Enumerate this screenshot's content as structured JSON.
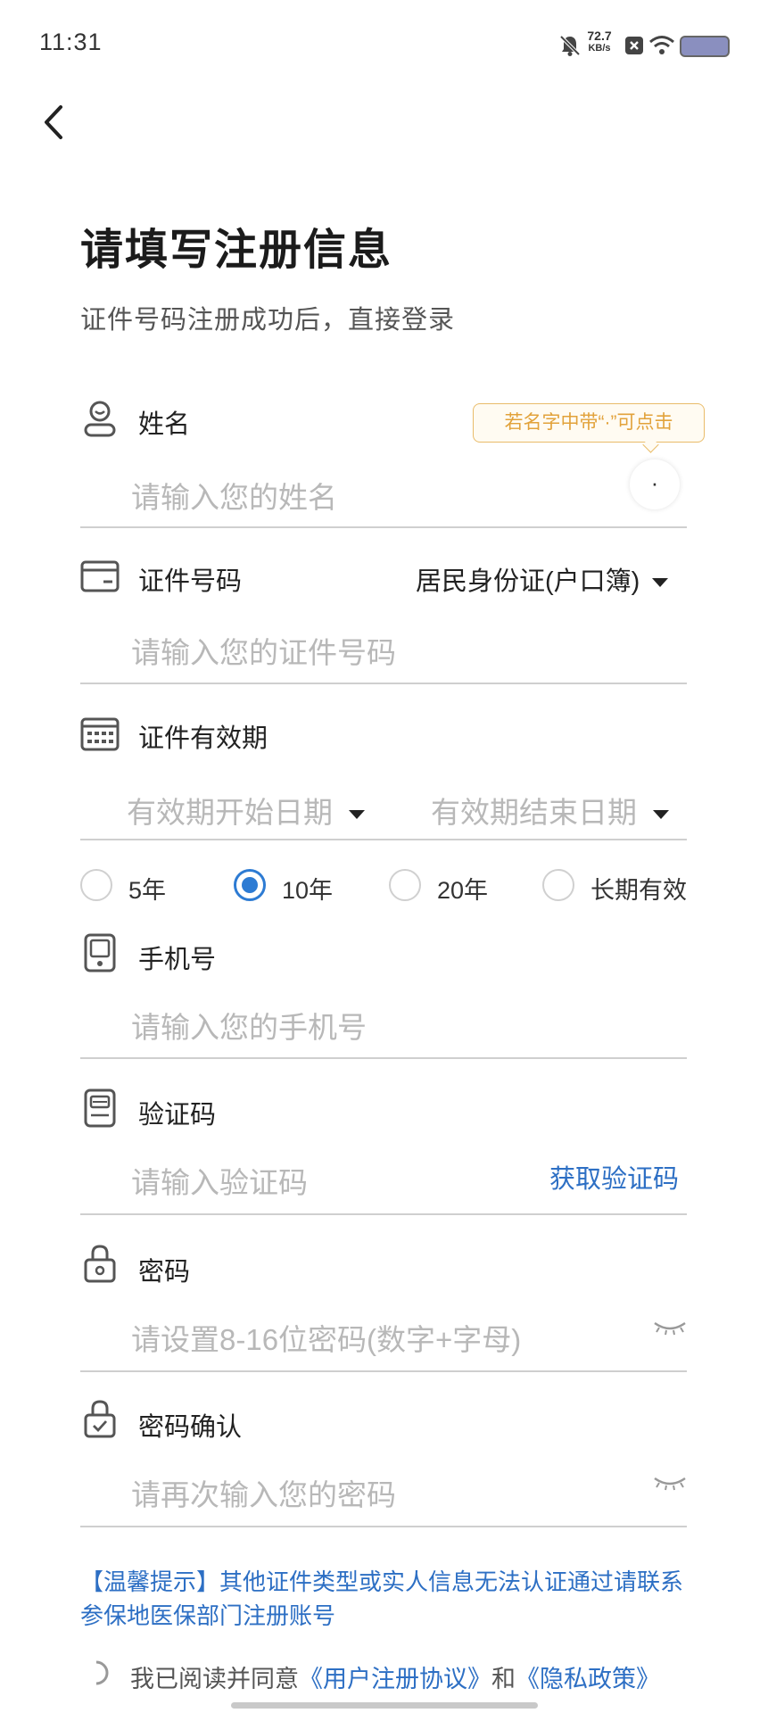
{
  "status_bar": {
    "time": "11:31",
    "speed_value": "72.7",
    "speed_unit": "KB/s",
    "icons": [
      "mute-bell-icon",
      "close-box-icon",
      "wifi-icon",
      "battery-icon"
    ]
  },
  "header": {
    "title": "请填写注册信息",
    "subtitle": "证件号码注册成功后，直接登录"
  },
  "name_field": {
    "label": "姓名",
    "placeholder": "请输入您的姓名",
    "tooltip": "若名字中带“·”可点击",
    "dot_button": "·"
  },
  "id_field": {
    "label": "证件号码",
    "doc_type": "居民身份证(户口簿)",
    "placeholder": "请输入您的证件号码"
  },
  "validity_field": {
    "label": "证件有效期",
    "start_placeholder": "有效期开始日期",
    "end_placeholder": "有效期结束日期",
    "options": [
      "5年",
      "10年",
      "20年",
      "长期有效"
    ],
    "selected": "10年"
  },
  "phone_field": {
    "label": "手机号",
    "placeholder": "请输入您的手机号"
  },
  "code_field": {
    "label": "验证码",
    "placeholder": "请输入验证码",
    "get_code": "获取验证码"
  },
  "password_field": {
    "label": "密码",
    "placeholder": "请设置8-16位密码(数字+字母)"
  },
  "confirm_field": {
    "label": "密码确认",
    "placeholder": "请再次输入您的密码"
  },
  "notice": "【温馨提示】其他证件类型或实人信息无法认证通过请联系参保地医保部门注册账号",
  "agreement": {
    "prefix": "我已阅读并同意",
    "user_agreement": "《用户注册协议》",
    "and": "和",
    "privacy_policy": "《隐私政策》"
  },
  "colors": {
    "accent": "#2d7bd3",
    "link": "#2d6fc4",
    "tooltip_border": "#e9bc6a",
    "tooltip_text": "#e2a23a",
    "placeholder": "#b8b8b8"
  }
}
